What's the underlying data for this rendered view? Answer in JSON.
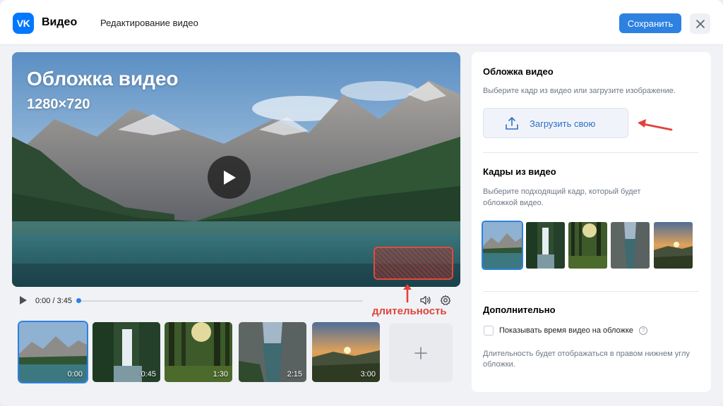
{
  "header": {
    "logo_text": "VK",
    "app_title": "Видео",
    "subtitle": "Редактирование видео",
    "save_label": "Сохранить",
    "close_icon": "close-icon"
  },
  "preview": {
    "cover_title": "Обложка видео",
    "cover_size": "1280×720",
    "play_icon": "play-icon"
  },
  "player": {
    "time": "0:00 / 3:45",
    "progress": 0.0,
    "volume_icon": "volume-icon",
    "settings_icon": "gear-icon"
  },
  "annotation": {
    "label": "длительность",
    "color": "#e0433a"
  },
  "thumbnails": [
    {
      "time": "0:00",
      "scene": "lake",
      "selected": true
    },
    {
      "time": "0:45",
      "scene": "waterfall",
      "selected": false
    },
    {
      "time": "1:30",
      "scene": "forest",
      "selected": false
    },
    {
      "time": "2:15",
      "scene": "canyon",
      "selected": false
    },
    {
      "time": "3:00",
      "scene": "sunset",
      "selected": false
    }
  ],
  "panel": {
    "cover_section": {
      "title": "Обложка видео",
      "description": "Выберите кадр из видео или загрузите изображение.",
      "upload_label": "Загрузить свою"
    },
    "frames_section": {
      "title": "Кадры из видео",
      "description_line1": "Выберите подходящий кадр, который будет",
      "description_line2": "обложкой видео."
    },
    "extra_section": {
      "title": "Дополнительно",
      "checkbox_label": "Показывать время видео на обложке",
      "checkbox_checked": false,
      "note_line1": "Длительность будет отображаться в правом нижнем углу",
      "note_line2": "обложки."
    }
  },
  "colors": {
    "accent": "#2d81e0",
    "brand": "#0077ff",
    "annotation": "#e0433a"
  }
}
